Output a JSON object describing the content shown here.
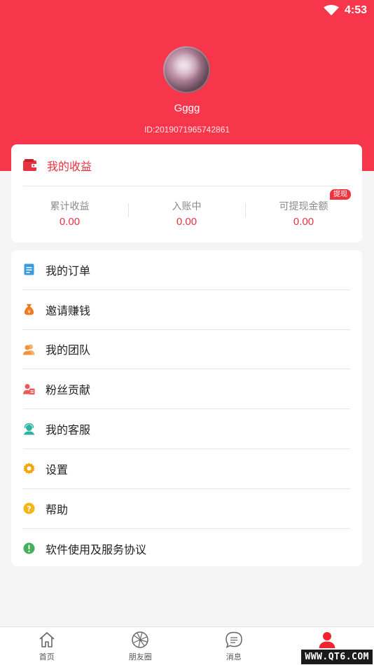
{
  "status_bar": {
    "time": "4:53"
  },
  "profile": {
    "username": "Gggg",
    "user_id": "ID:2019071965742861"
  },
  "earnings": {
    "title": "我的收益",
    "withdraw_badge": "提现",
    "stats": [
      {
        "label": "累计收益",
        "value": "0.00"
      },
      {
        "label": "入账中",
        "value": "0.00"
      },
      {
        "label": "可提现金额",
        "value": "0.00"
      }
    ]
  },
  "menu": {
    "items": [
      {
        "label": "我的订单",
        "icon": "order-icon",
        "color": "#3a9be0"
      },
      {
        "label": "邀请赚钱",
        "icon": "money-bag-icon",
        "color": "#f07b1f"
      },
      {
        "label": "我的团队",
        "icon": "team-icon",
        "color": "#f3923a"
      },
      {
        "label": "粉丝贡献",
        "icon": "fans-icon",
        "color": "#ec5a58"
      },
      {
        "label": "我的客服",
        "icon": "customer-service-icon",
        "color": "#2bb3a3"
      },
      {
        "label": "设置",
        "icon": "gear-icon",
        "color": "#f5a60a"
      },
      {
        "label": "帮助",
        "icon": "help-icon",
        "color": "#f5b418"
      },
      {
        "label": "软件使用及服务协议",
        "icon": "info-icon",
        "color": "#43b05c"
      }
    ]
  },
  "tabbar": {
    "tabs": [
      {
        "label": "首页",
        "icon": "home-icon"
      },
      {
        "label": "朋友圈",
        "icon": "aperture-icon"
      },
      {
        "label": "消息",
        "icon": "message-icon"
      },
      {
        "label": "",
        "icon": "profile-icon",
        "active": true
      }
    ]
  },
  "watermark": "WWW.QT6.COM",
  "colors": {
    "brand": "#f7364b",
    "accent_text": "#e9323f"
  }
}
